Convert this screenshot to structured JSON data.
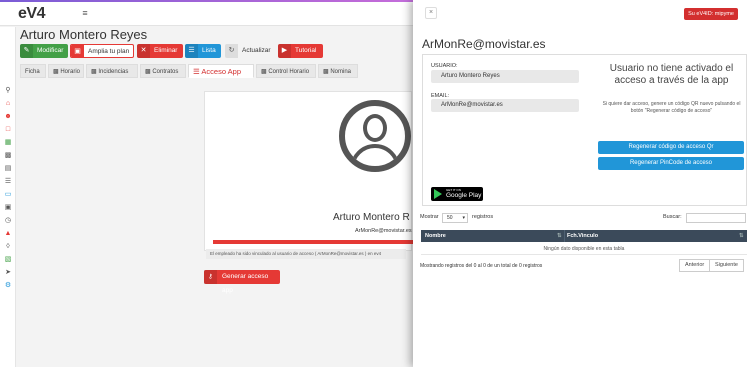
{
  "app": {
    "logo": "eV4",
    "menu_icon": "hamburger-icon"
  },
  "sidebar": {
    "icons": [
      "search-icon",
      "home-icon",
      "user-icon",
      "building-icon",
      "chart-icon",
      "calendar-icon",
      "document-icon",
      "list-icon",
      "card-icon",
      "box-icon",
      "clock-icon",
      "megaphone-icon",
      "bell-icon",
      "book-icon",
      "logout-icon",
      "settings-icon"
    ]
  },
  "page": {
    "title": "Arturo Montero Reyes"
  },
  "toolbar": {
    "modificar": "Modificar",
    "ampliar": "Amplia tu plan",
    "eliminar": "Eliminar",
    "lista": "Lista",
    "actualizar": "Actualizar",
    "tutorial": "Tutorial"
  },
  "tabs": [
    "Ficha",
    "Horario",
    "Incidencias",
    "Contratos",
    "Acceso App",
    "Control Horario",
    "Nomina"
  ],
  "active_tab": "Acceso App",
  "profile": {
    "name": "Arturo Montero R",
    "email": "ArMonRe@movistar.es"
  },
  "note": "El empleado ha sido vinculado al usuario de acceso ( ArMonRe@movistar.es ) en ev4",
  "generate_button": "Generar acceso app",
  "modal": {
    "close": "×",
    "user_badge": "Su eV4ID: mipyme",
    "title": "ArMonRe@movistar.es",
    "usuario_label": "USUARIO:",
    "usuario_value": "Arturo Montero Reyes",
    "email_label": "EMAIL:",
    "email_value": "ArMonRe@movistar.es",
    "status_title": "Usuario no tiene activado el acceso a través de la app",
    "status_desc": "Si quiere dar acceso, genere un código QR nuevo pulsando el botón \"Regenerar código de acceso\"",
    "btn_qr": "Regenerar código de acceso Qr",
    "btn_pin": "Regenerar PinCode de acceso",
    "gplay_small": "GET IT ON",
    "gplay_big": "Google Play"
  },
  "table": {
    "show_label": "Mostrar",
    "show_value": "50",
    "records_label": "registros",
    "search_label": "Buscar:",
    "columns": [
      "Nombre",
      "Fch.Vinculo"
    ],
    "empty": "Ningún dato disponible en esta tabla",
    "info": "Mostrando registros del 0 al 0 de un total de 0 registros",
    "prev": "Anterior",
    "next": "Siguiente"
  },
  "colors": {
    "green": "#43a047",
    "red": "#e53935",
    "blue": "#2196d8",
    "dark_header": "#3b4a5a"
  }
}
